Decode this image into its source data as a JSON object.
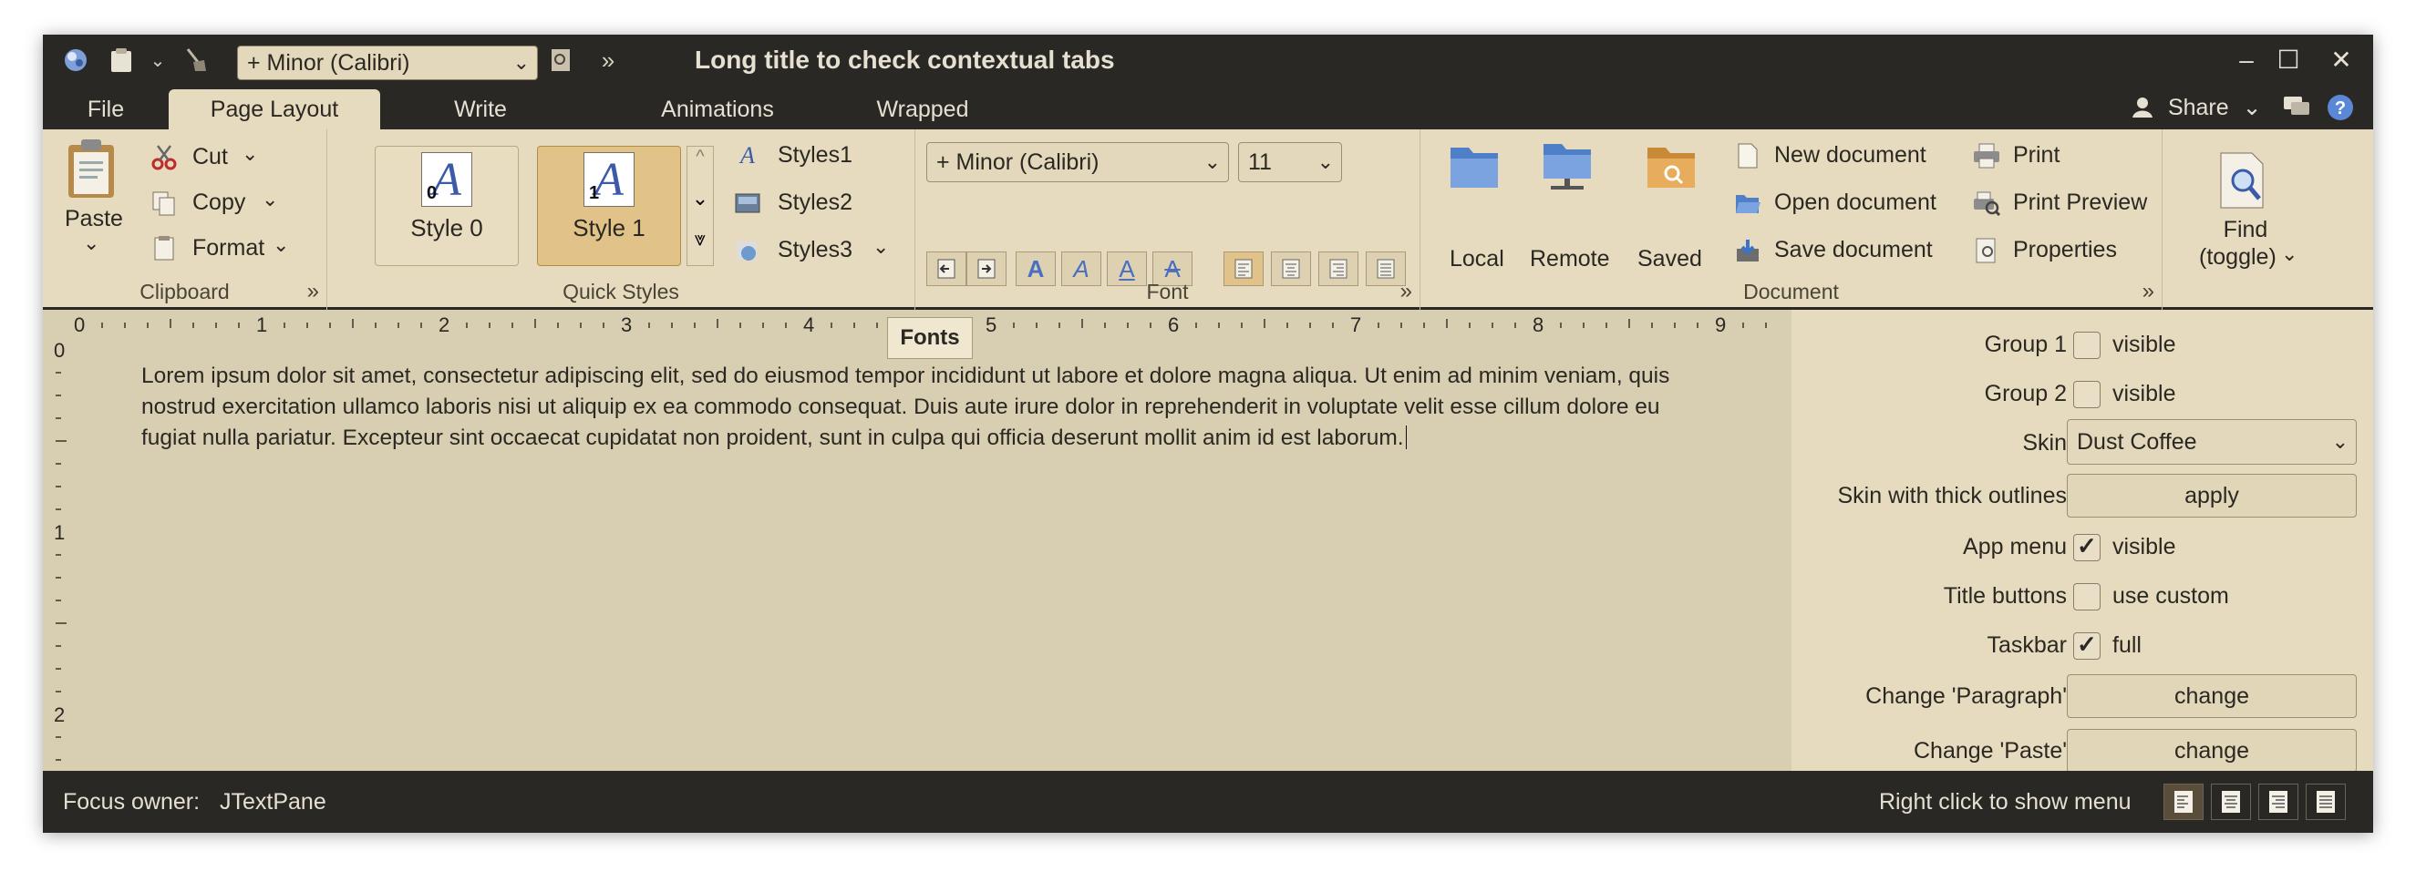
{
  "window": {
    "title": "Long title to check contextual tabs",
    "font_combo": "+ Minor (Calibri)"
  },
  "tabs": [
    {
      "label": "File"
    },
    {
      "label": "Page Layout"
    },
    {
      "label": "Write"
    },
    {
      "label": "Animations"
    },
    {
      "label": "Wrapped"
    }
  ],
  "share_label": "Share",
  "clipboard": {
    "paste": "Paste",
    "cut": "Cut",
    "copy": "Copy",
    "format": "Format",
    "title": "Clipboard"
  },
  "quick_styles": {
    "style0": "Style 0",
    "style1": "Style 1",
    "style0_num": "0",
    "style1_num": "1",
    "styles1": "Styles1",
    "styles2": "Styles2",
    "styles3": "Styles3",
    "title": "Quick Styles"
  },
  "font": {
    "family": "+ Minor (Calibri)",
    "size": "11",
    "title": "Font",
    "tooltip": "Fonts"
  },
  "document": {
    "local": "Local",
    "remote": "Remote",
    "saved": "Saved",
    "new_document": "New document",
    "open_document": "Open document",
    "save_document": "Save document",
    "print": "Print",
    "print_preview": "Print Preview",
    "properties": "Properties",
    "title": "Document"
  },
  "find": {
    "line1": "Find",
    "line2": "(toggle)"
  },
  "ruler": {
    "h_numbers": [
      "0",
      "1",
      "2",
      "3",
      "4",
      "5",
      "6",
      "7",
      "8",
      "9"
    ],
    "v_numbers": [
      "0",
      "1",
      "2"
    ]
  },
  "editor_text": "Lorem ipsum dolor sit amet, consectetur adipiscing elit, sed do eiusmod tempor incididunt ut labore et dolore magna aliqua. Ut enim ad minim veniam, quis nostrud exercitation ullamco laboris nisi ut aliquip ex ea commodo consequat. Duis aute irure dolor in reprehenderit in voluptate velit esse cillum dolore eu fugiat nulla pariatur. Excepteur sint occaecat cupidatat non proident, sunt in culpa qui officia deserunt mollit anim id est laborum.",
  "panel": {
    "group1": {
      "label": "Group 1",
      "check": "visible",
      "checked": false
    },
    "group2": {
      "label": "Group 2",
      "check": "visible",
      "checked": false
    },
    "skin": {
      "label": "Skin",
      "value": "Dust Coffee"
    },
    "skin_thick": {
      "label": "Skin with thick outlines",
      "button": "apply"
    },
    "app_menu": {
      "label": "App menu",
      "check": "visible",
      "checked": true
    },
    "title_buttons": {
      "label": "Title buttons",
      "check": "use custom",
      "checked": false
    },
    "taskbar": {
      "label": "Taskbar",
      "check": "full",
      "checked": true
    },
    "change_paragraph": {
      "label": "Change 'Paragraph'",
      "button": "change"
    },
    "change_paste": {
      "label": "Change 'Paste'",
      "button": "change"
    }
  },
  "status": {
    "focus_label": "Focus owner:",
    "focus_value": "JTextPane",
    "right_hint": "Right click to show menu"
  }
}
